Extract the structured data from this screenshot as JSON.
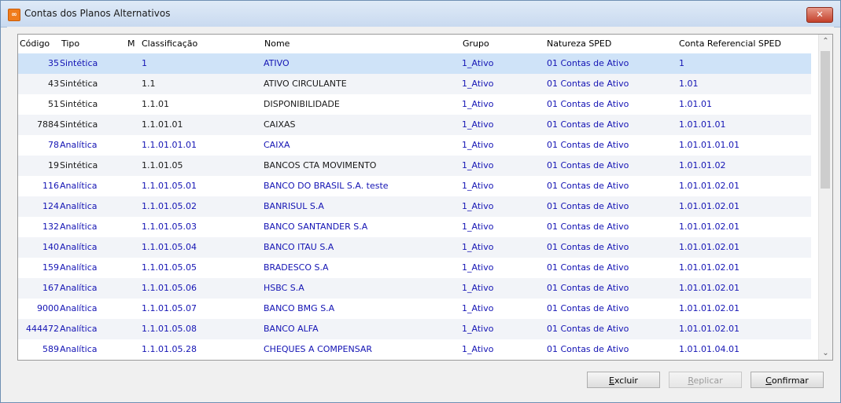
{
  "window": {
    "title": "Contas dos Planos Alternativos",
    "close_label": "✕"
  },
  "grid": {
    "columns": [
      "Código",
      "Tipo",
      "M",
      "Classificação",
      "Nome",
      "Grupo",
      "Natureza SPED",
      "Conta Referencial SPED"
    ],
    "selected_row": 0,
    "rows": [
      {
        "codigo": "35",
        "tipo": "Sintética",
        "classificacao": "1",
        "nome": "ATIVO",
        "grupo": "1_Ativo",
        "natureza": "01 Contas de Ativo",
        "ref": "1",
        "style": "blue"
      },
      {
        "codigo": "43",
        "tipo": "Sintética",
        "classificacao": "1.1",
        "nome": "ATIVO CIRCULANTE",
        "grupo": "1_Ativo",
        "natureza": "01 Contas de Ativo",
        "ref": "1.01",
        "style": "black"
      },
      {
        "codigo": "51",
        "tipo": "Sintética",
        "classificacao": "1.1.01",
        "nome": "DISPONIBILIDADE",
        "grupo": "1_Ativo",
        "natureza": "01 Contas de Ativo",
        "ref": "1.01.01",
        "style": "black"
      },
      {
        "codigo": "7884",
        "tipo": "Sintética",
        "classificacao": "1.1.01.01",
        "nome": "CAIXAS",
        "grupo": "1_Ativo",
        "natureza": "01 Contas de Ativo",
        "ref": "1.01.01.01",
        "style": "black"
      },
      {
        "codigo": "78",
        "tipo": "Analítica",
        "classificacao": "1.1.01.01.01",
        "nome": "CAIXA",
        "grupo": "1_Ativo",
        "natureza": "01 Contas de Ativo",
        "ref": "1.01.01.01.01",
        "style": "blue"
      },
      {
        "codigo": "19",
        "tipo": "Sintética",
        "classificacao": "1.1.01.05",
        "nome": "BANCOS CTA MOVIMENTO",
        "grupo": "1_Ativo",
        "natureza": "01 Contas de Ativo",
        "ref": "1.01.01.02",
        "style": "black"
      },
      {
        "codigo": "116",
        "tipo": "Analítica",
        "classificacao": "1.1.01.05.01",
        "nome": "BANCO DO BRASIL S.A. teste",
        "grupo": "1_Ativo",
        "natureza": "01 Contas de Ativo",
        "ref": "1.01.01.02.01",
        "style": "blue"
      },
      {
        "codigo": "124",
        "tipo": "Analítica",
        "classificacao": "1.1.01.05.02",
        "nome": "BANRISUL S.A",
        "grupo": "1_Ativo",
        "natureza": "01 Contas de Ativo",
        "ref": "1.01.01.02.01",
        "style": "blue"
      },
      {
        "codigo": "132",
        "tipo": "Analítica",
        "classificacao": "1.1.01.05.03",
        "nome": "BANCO SANTANDER S.A",
        "grupo": "1_Ativo",
        "natureza": "01 Contas de Ativo",
        "ref": "1.01.01.02.01",
        "style": "blue"
      },
      {
        "codigo": "140",
        "tipo": "Analítica",
        "classificacao": "1.1.01.05.04",
        "nome": "BANCO ITAU S.A",
        "grupo": "1_Ativo",
        "natureza": "01 Contas de Ativo",
        "ref": "1.01.01.02.01",
        "style": "blue"
      },
      {
        "codigo": "159",
        "tipo": "Analítica",
        "classificacao": "1.1.01.05.05",
        "nome": "BRADESCO S.A",
        "grupo": "1_Ativo",
        "natureza": "01 Contas de Ativo",
        "ref": "1.01.01.02.01",
        "style": "blue"
      },
      {
        "codigo": "167",
        "tipo": "Analítica",
        "classificacao": "1.1.01.05.06",
        "nome": "HSBC S.A",
        "grupo": "1_Ativo",
        "natureza": "01 Contas de Ativo",
        "ref": "1.01.01.02.01",
        "style": "blue"
      },
      {
        "codigo": "9000",
        "tipo": "Analítica",
        "classificacao": "1.1.01.05.07",
        "nome": "BANCO BMG S.A",
        "grupo": "1_Ativo",
        "natureza": "01 Contas de Ativo",
        "ref": "1.01.01.02.01",
        "style": "blue"
      },
      {
        "codigo": "444472",
        "tipo": "Analítica",
        "classificacao": "1.1.01.05.08",
        "nome": "BANCO ALFA",
        "grupo": "1_Ativo",
        "natureza": "01 Contas de Ativo",
        "ref": "1.01.01.02.01",
        "style": "blue"
      },
      {
        "codigo": "589",
        "tipo": "Analítica",
        "classificacao": "1.1.01.05.28",
        "nome": "CHEQUES A COMPENSAR",
        "grupo": "1_Ativo",
        "natureza": "01 Contas de Ativo",
        "ref": "1.01.01.04.01",
        "style": "blue"
      }
    ]
  },
  "scrollbar": {
    "up_icon": "chevron-up-icon",
    "down_icon": "chevron-down-icon",
    "up_glyph": "⌃",
    "down_glyph": "⌄"
  },
  "buttons": {
    "excluir": {
      "accel": "E",
      "rest": "xcluir"
    },
    "replicar": {
      "accel": "R",
      "rest": "eplicar"
    },
    "confirmar": {
      "accel": "C",
      "rest": "onfirmar"
    }
  },
  "colors": {
    "selected": "#cfe3f8",
    "link_blue": "#1414b4",
    "alt_row": "#f2f4f8"
  }
}
